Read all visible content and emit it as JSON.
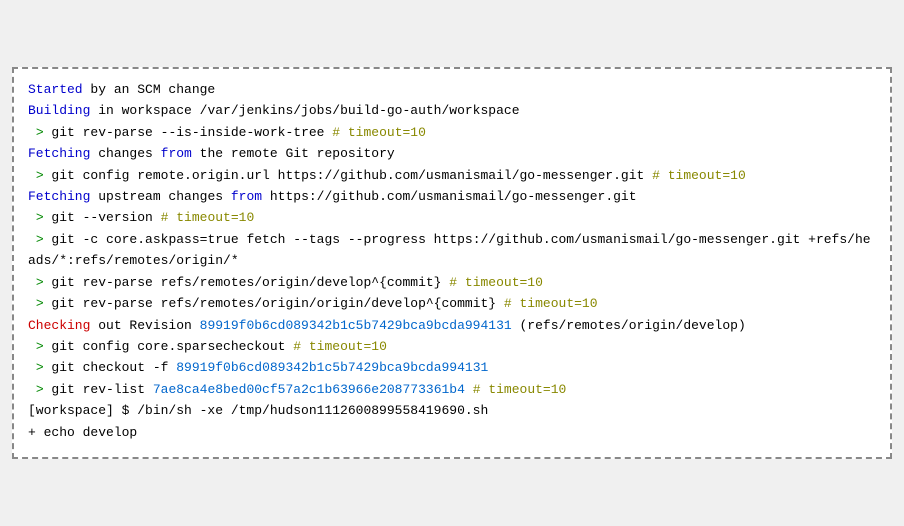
{
  "terminal": {
    "lines": [
      {
        "id": "line1",
        "parts": [
          {
            "text": "Started",
            "color": "blue"
          },
          {
            "text": " by an SCM change",
            "color": "default"
          }
        ]
      },
      {
        "id": "line2",
        "parts": [
          {
            "text": "Building",
            "color": "blue"
          },
          {
            "text": " in workspace /var/jenkins/jobs/build-go-auth/workspace",
            "color": "default"
          }
        ]
      },
      {
        "id": "line3",
        "parts": [
          {
            "text": " > ",
            "color": "green"
          },
          {
            "text": "git rev-parse --is-inside-work-tree ",
            "color": "default"
          },
          {
            "text": "# timeout=10",
            "color": "comment"
          }
        ]
      },
      {
        "id": "line4",
        "parts": [
          {
            "text": "Fetching",
            "color": "blue"
          },
          {
            "text": " changes ",
            "color": "default"
          },
          {
            "text": "from",
            "color": "blue"
          },
          {
            "text": " the remote Git repository",
            "color": "default"
          }
        ]
      },
      {
        "id": "line5",
        "parts": [
          {
            "text": " > ",
            "color": "green"
          },
          {
            "text": "git config remote.origin.url https://github.com/usmanismail/go-messenger.git ",
            "color": "default"
          },
          {
            "text": "# timeout=10",
            "color": "comment"
          }
        ]
      },
      {
        "id": "line6",
        "parts": [
          {
            "text": "Fetching",
            "color": "blue"
          },
          {
            "text": " upstream changes ",
            "color": "default"
          },
          {
            "text": "from",
            "color": "blue"
          },
          {
            "text": " https://github.com/usmanismail/go-messenger.git",
            "color": "default"
          }
        ]
      },
      {
        "id": "line7",
        "parts": [
          {
            "text": " > ",
            "color": "green"
          },
          {
            "text": "git --version ",
            "color": "default"
          },
          {
            "text": "# timeout=10",
            "color": "comment"
          }
        ]
      },
      {
        "id": "line8",
        "parts": [
          {
            "text": " > ",
            "color": "green"
          },
          {
            "text": "git -c core.askpass=true fetch --tags --progress https://github.com/usmanismail/go-messenger.git +refs/heads/*:refs/remotes/origin/*",
            "color": "default"
          }
        ]
      },
      {
        "id": "line9",
        "parts": [
          {
            "text": " > ",
            "color": "green"
          },
          {
            "text": "git rev-parse refs/remotes/origin/develop^{commit} ",
            "color": "default"
          },
          {
            "text": "# timeout=10",
            "color": "comment"
          }
        ]
      },
      {
        "id": "line10",
        "parts": [
          {
            "text": " > ",
            "color": "green"
          },
          {
            "text": "git rev-parse refs/remotes/origin/origin/develop^{commit} ",
            "color": "default"
          },
          {
            "text": "# timeout=10",
            "color": "comment"
          }
        ]
      },
      {
        "id": "line11",
        "parts": [
          {
            "text": "Checking",
            "color": "red"
          },
          {
            "text": " out Revision ",
            "color": "default"
          },
          {
            "text": "89919f0b6cd089342b1c5b7429bca9bcda994131",
            "color": "hash"
          },
          {
            "text": " (refs/remotes/origin/develop)",
            "color": "default"
          }
        ]
      },
      {
        "id": "line12",
        "parts": [
          {
            "text": " > ",
            "color": "green"
          },
          {
            "text": "git config core.sparsecheckout ",
            "color": "default"
          },
          {
            "text": "# timeout=10",
            "color": "comment"
          }
        ]
      },
      {
        "id": "line13",
        "parts": [
          {
            "text": " > ",
            "color": "green"
          },
          {
            "text": "git checkout -f ",
            "color": "default"
          },
          {
            "text": "89919f0b6cd089342b1c5b7429bca9bcda994131",
            "color": "hash"
          }
        ]
      },
      {
        "id": "line14",
        "parts": [
          {
            "text": " > ",
            "color": "green"
          },
          {
            "text": "git rev-list ",
            "color": "default"
          },
          {
            "text": "7ae8ca4e8bed00cf57a2c1b63966e208773361b4",
            "color": "hash"
          },
          {
            "text": " ",
            "color": "default"
          },
          {
            "text": "# timeout=10",
            "color": "comment"
          }
        ]
      },
      {
        "id": "line15",
        "parts": [
          {
            "text": "[workspace] $ /bin/sh -xe /tmp/hudson111260089955841969​0.sh",
            "color": "default"
          }
        ]
      },
      {
        "id": "line16",
        "parts": [
          {
            "text": "+ echo develop",
            "color": "default"
          }
        ]
      }
    ]
  }
}
